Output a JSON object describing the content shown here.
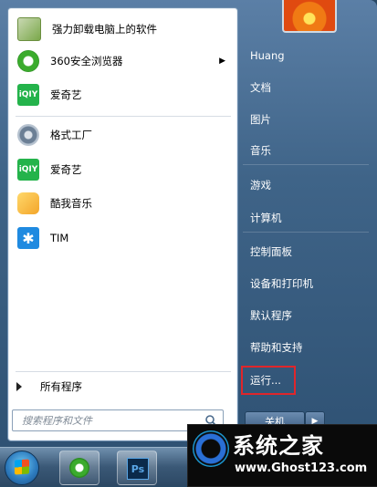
{
  "start_menu": {
    "programs": [
      {
        "label": "强力卸载电脑上的软件",
        "icon": "uninstaller-icon",
        "color": "#7aa84a"
      },
      {
        "label": "360安全浏览器",
        "icon": "360-browser-icon",
        "color": "#3bab2d",
        "submenu": true
      },
      {
        "label": "爱奇艺",
        "icon": "iqiyi-icon",
        "color": "#24b34b"
      },
      {
        "label": "格式工厂",
        "icon": "format-factory-icon",
        "color": "#6b7f95"
      },
      {
        "label": "爱奇艺",
        "icon": "iqiyi-icon",
        "color": "#24b34b"
      },
      {
        "label": "酷我音乐",
        "icon": "kuwo-music-icon",
        "color": "#f3a52a"
      },
      {
        "label": "TIM",
        "icon": "tim-icon",
        "color": "#1f8ae0"
      }
    ],
    "all_programs_label": "所有程序",
    "search_placeholder": "搜索程序和文件",
    "right_items": [
      "Huang",
      "文档",
      "图片",
      "音乐",
      "游戏",
      "计算机",
      "控制面板",
      "设备和打印机",
      "默认程序",
      "帮助和支持",
      "运行..."
    ],
    "shutdown_label": "关机",
    "highlight_color": "#e0262b"
  },
  "taskbar": {
    "apps": [
      "360-browser-icon",
      "photoshop-icon"
    ],
    "photoshop_label": "Ps"
  },
  "watermark": {
    "title": "系统之家",
    "url": "www.Ghost123.com"
  }
}
